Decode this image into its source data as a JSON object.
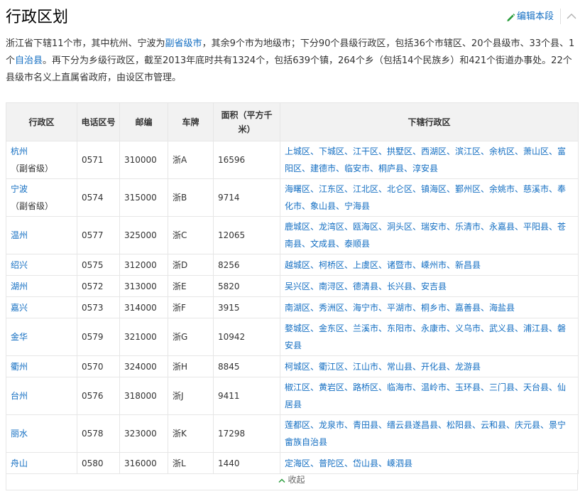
{
  "header": {
    "title": "行政区划",
    "edit_label": "编辑本段"
  },
  "intro": {
    "parts": [
      {
        "text": "浙江省下辖11个市，其中杭州、宁波为",
        "link": false
      },
      {
        "text": "副省级市",
        "link": true
      },
      {
        "text": "，其余9个市为地级市；下分90个县级行政区，包括36个市辖区、20个县级市、33个县、1个",
        "link": false
      },
      {
        "text": "自治县",
        "link": true
      },
      {
        "text": "。再下分为乡级行政区，截至2013年底时共有1324个，包括639个镇，264个乡（包括14个民族乡）和421个街道办事处。22个县级市名义上直属省政府，由设区市管理。",
        "link": false
      }
    ]
  },
  "table": {
    "headers": [
      "行政区",
      "电话区号",
      "邮编",
      "车牌",
      "面积（平方千米）",
      "下辖行政区"
    ],
    "rows": [
      {
        "city": "杭州",
        "sub": "（副省级）",
        "code": "0571",
        "zip": "310000",
        "plate": "浙A",
        "area": "16596",
        "districts": "上城区、下城区、江干区、拱墅区、西湖区、滨江区、余杭区、萧山区、富阳区、建德市、临安市、桐庐县、淳安县"
      },
      {
        "city": "宁波",
        "sub": "（副省级）",
        "code": "0574",
        "zip": "315000",
        "plate": "浙B",
        "area": "9714",
        "districts": "海曙区、江东区、江北区、北仑区、镇海区、鄞州区、余姚市、慈溪市、奉化市、象山县、宁海县"
      },
      {
        "city": "温州",
        "sub": "",
        "code": "0577",
        "zip": "325000",
        "plate": "浙C",
        "area": "12065",
        "districts": "鹿城区、龙湾区、瓯海区、洞头区、瑞安市、乐清市、永嘉县、平阳县、苍南县、文成县、泰顺县"
      },
      {
        "city": "绍兴",
        "sub": "",
        "code": "0575",
        "zip": "312000",
        "plate": "浙D",
        "area": "8256",
        "districts": "越城区、柯桥区、上虞区、诸暨市、嵊州市、新昌县"
      },
      {
        "city": "湖州",
        "sub": "",
        "code": "0572",
        "zip": "313000",
        "plate": "浙E",
        "area": "5820",
        "districts": "吴兴区、南浔区、德清县、长兴县、安吉县"
      },
      {
        "city": "嘉兴",
        "sub": "",
        "code": "0573",
        "zip": "314000",
        "plate": "浙F",
        "area": "3915",
        "districts": "南湖区、秀洲区、海宁市、平湖市、桐乡市、嘉善县、海盐县"
      },
      {
        "city": "金华",
        "sub": "",
        "code": "0579",
        "zip": "321000",
        "plate": "浙G",
        "area": "10942",
        "districts": "婺城区、金东区、兰溪市、东阳市、永康市、义乌市、武义县、浦江县、磐安县"
      },
      {
        "city": "衢州",
        "sub": "",
        "code": "0570",
        "zip": "324000",
        "plate": "浙H",
        "area": "8845",
        "districts": "柯城区、衢江区、江山市、常山县、开化县、龙游县"
      },
      {
        "city": "台州",
        "sub": "",
        "code": "0576",
        "zip": "318000",
        "plate": "浙J",
        "area": "9411",
        "districts": "椒江区、黄岩区、路桥区、临海市、温岭市、玉环县、三门县、天台县、仙居县"
      },
      {
        "city": "丽水",
        "sub": "",
        "code": "0578",
        "zip": "323000",
        "plate": "浙K",
        "area": "17298",
        "districts": "莲都区、龙泉市、青田县、缙云县遂昌县、松阳县、云和县、庆元县、景宁畲族自治县"
      },
      {
        "city": "舟山",
        "sub": "",
        "code": "0580",
        "zip": "316000",
        "plate": "浙L",
        "area": "1440",
        "districts": "定海区、普陀区、岱山县、嵊泗县"
      }
    ]
  },
  "footer": {
    "collapse_label": "收起"
  },
  "colors": {
    "link": "#136ec2",
    "header_bg": "#f2f2f2",
    "border": "#e6e6e6"
  }
}
